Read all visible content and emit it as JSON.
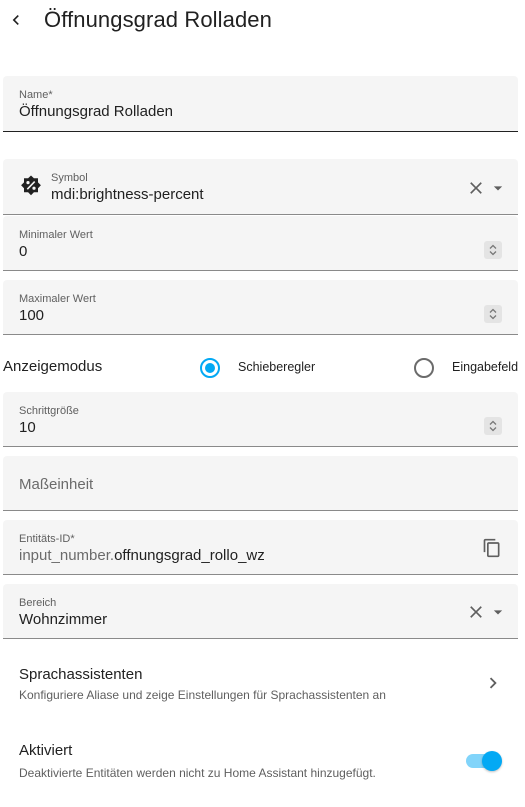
{
  "header": {
    "title": "Öffnungsgrad Rolladen"
  },
  "fields": {
    "name": {
      "label": "Name*",
      "value": "Öffnungsgrad Rolladen"
    },
    "symbol": {
      "label": "Symbol",
      "value": "mdi:brightness-percent",
      "icon": "brightness-percent-icon"
    },
    "min": {
      "label": "Minimaler Wert",
      "value": "0"
    },
    "max": {
      "label": "Maximaler Wert",
      "value": "100"
    },
    "step": {
      "label": "Schrittgröße",
      "value": "10"
    },
    "unit": {
      "placeholder": "Maßeinheit"
    },
    "entity_id": {
      "label": "Entitäts-ID*",
      "prefix": "input_number.",
      "value": "offnungsgrad_rollo_wz"
    },
    "area": {
      "label": "Bereich",
      "value": "Wohnzimmer"
    }
  },
  "display_mode": {
    "label": "Anzeigemodus",
    "options": [
      {
        "label": "Schieberegler",
        "selected": true
      },
      {
        "label": "Eingabefeld",
        "selected": false
      }
    ]
  },
  "voice": {
    "title": "Sprachassistenten",
    "subtitle": "Konfiguriere Aliase und zeige Einstellungen für Sprachassistenten an"
  },
  "enabled": {
    "title": "Aktiviert",
    "subtitle": "Deaktivierte Entitäten werden nicht zu Home Assistant hinzugefügt.",
    "on": true
  },
  "colors": {
    "accent": "#03a9f4",
    "field_bg": "#f5f5f5"
  }
}
